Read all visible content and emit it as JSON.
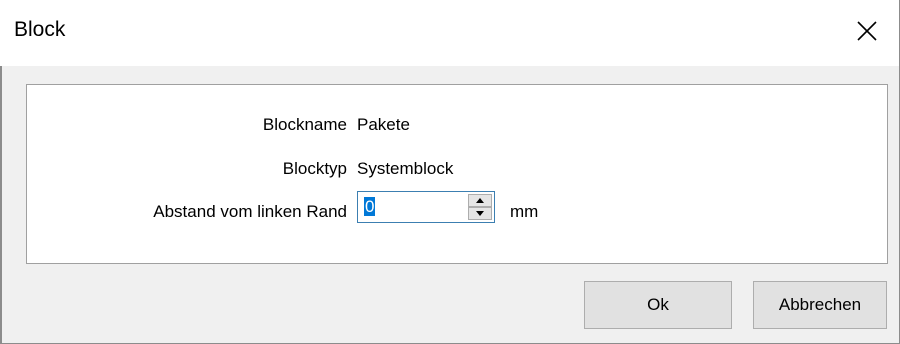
{
  "window": {
    "title": "Block",
    "close_icon": "close-icon"
  },
  "form": {
    "blockname_label": "Blockname",
    "blockname_value": "Pakete",
    "blocktyp_label": "Blocktyp",
    "blocktyp_value": "Systemblock",
    "abstand_label": "Abstand vom linken Rand",
    "abstand_value": "0",
    "abstand_unit": "mm"
  },
  "buttons": {
    "ok_label": "Ok",
    "cancel_label": "Abbrechen"
  }
}
